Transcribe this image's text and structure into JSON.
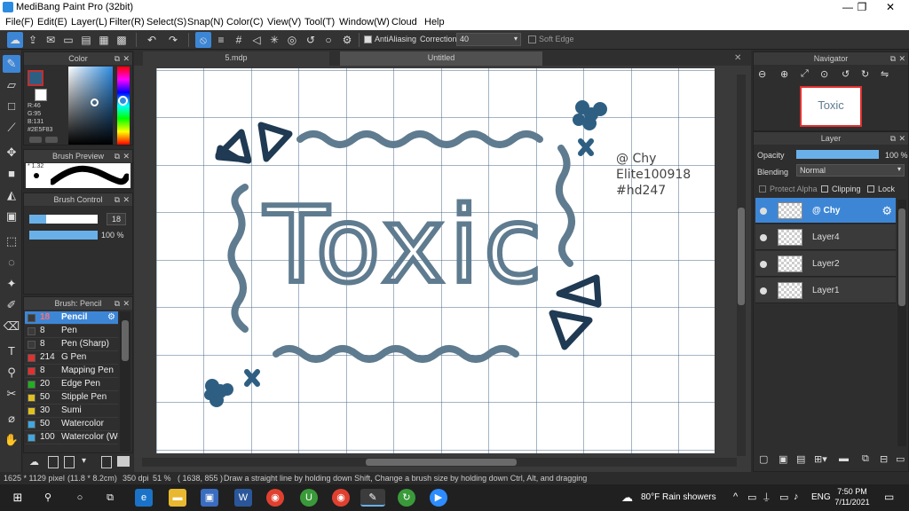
{
  "window": {
    "title": "MediBang Paint Pro (32bit)",
    "minimize": "—",
    "maximize": "❐",
    "close": "✕"
  },
  "menu": [
    "File(F)",
    "Edit(E)",
    "Layer(L)",
    "Filter(R)",
    "Select(S)",
    "Snap(N)",
    "Color(C)",
    "View(V)",
    "Tool(T)",
    "Window(W)",
    "Cloud",
    "Help"
  ],
  "toolbar": {
    "antialiasing_label": "AntiAliasing",
    "correction_label": "Correction",
    "correction_value": "40",
    "soft_edge_label": "Soft Edge"
  },
  "color_panel": {
    "title": "Color",
    "r": "R:46",
    "g": "G:95",
    "b": "B:131",
    "hex": "#2E5F83",
    "current_color": "#2e5f83"
  },
  "brush_preview": {
    "title": "Brush Preview",
    "size_label": "* 1.32"
  },
  "brush_control": {
    "title": "Brush Control",
    "size": "18",
    "opacity": "100 %",
    "size_fraction": 0.25,
    "opacity_fraction": 1.0
  },
  "brush_list": {
    "title": "Brush: Pencil",
    "items": [
      {
        "size": "18",
        "name": "Pencil",
        "color": "#3a3a3a",
        "selected": true
      },
      {
        "size": "8",
        "name": "Pen",
        "color": "#3a3a3a"
      },
      {
        "size": "8",
        "name": "Pen (Sharp)",
        "color": "#3a3a3a"
      },
      {
        "size": "214",
        "name": "G Pen",
        "color": "#e03030"
      },
      {
        "size": "8",
        "name": "Mapping Pen",
        "color": "#e03030"
      },
      {
        "size": "20",
        "name": "Edge Pen",
        "color": "#20b020"
      },
      {
        "size": "50",
        "name": "Stipple Pen",
        "color": "#e0c020"
      },
      {
        "size": "30",
        "name": "Sumi",
        "color": "#e0c020"
      },
      {
        "size": "50",
        "name": "Watercolor",
        "color": "#40a8e0"
      },
      {
        "size": "100",
        "name": "Watercolor (We",
        "color": "#40a8e0"
      }
    ]
  },
  "tabs": [
    {
      "label": "5.mdp"
    },
    {
      "label": "Untitled"
    }
  ],
  "canvas": {
    "artwork_text": "Toxic",
    "credit_lines": [
      "@ Chy",
      "Elite100918",
      "#hd247"
    ]
  },
  "navigator": {
    "title": "Navigator",
    "thumb_text": "Toxic"
  },
  "layer_panel": {
    "title": "Layer",
    "opacity_label": "Opacity",
    "opacity_value": "100 %",
    "blending_label": "Blending",
    "blending_value": "Normal",
    "protect_alpha": "Protect Alpha",
    "clipping": "Clipping",
    "lock": "Lock",
    "layers": [
      {
        "name": "@ Chy",
        "selected": true
      },
      {
        "name": "Layer4"
      },
      {
        "name": "Layer2"
      },
      {
        "name": "Layer1"
      }
    ]
  },
  "status": {
    "size": "1625 * 1129 pixel",
    "dims": "(11.8 * 8.2cm)",
    "dpi": "350 dpi",
    "zoom": "51 %",
    "coords": "( 1638, 855 )",
    "hint": "Draw a straight line by holding down Shift, Change a brush size by holding down Ctrl, Alt, and dragging"
  },
  "taskbar": {
    "weather": "80°F  Rain showers",
    "lang": "ENG",
    "time": "7:50 PM",
    "date": "7/11/2021"
  },
  "colors": {
    "accent": "#3d86d6",
    "ink": "#1f3a52",
    "stroke": "#5f7b8f",
    "accent_blue": "#2e5f83"
  }
}
